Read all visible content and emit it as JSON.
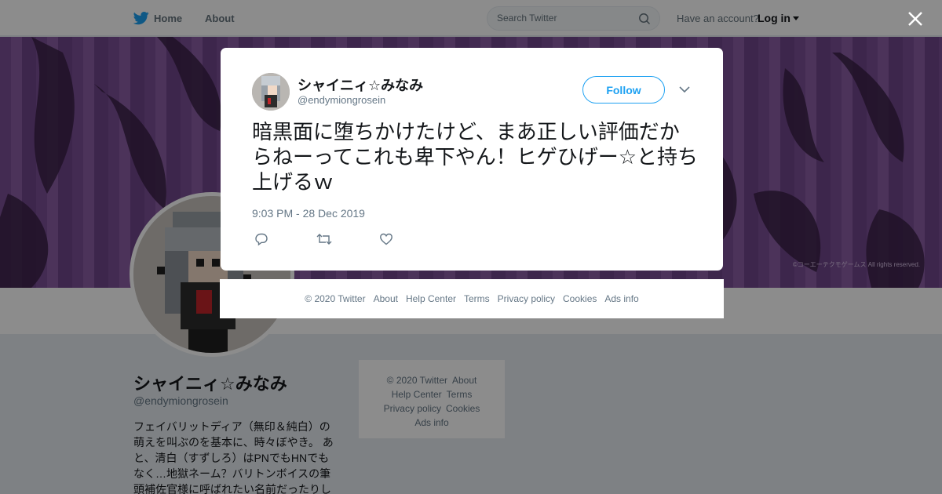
{
  "nav": {
    "home_label": "Home",
    "about_label": "About",
    "search_placeholder": "Search Twitter",
    "account_prompt": "Have an account?",
    "login_label": "Log in"
  },
  "banner": {
    "copyright": "©コーエーテクモゲームス All rights reserved."
  },
  "profile": {
    "name": "シャイニィ☆みなみ",
    "handle": "@endymiongrosein",
    "bio": "フェイバリットディア（無印＆純白）の萌えを叫ぶのを基本に、時々ぼやき。 あと、清白（すずしろ）はPNでもHNでもなく…地獄ネーム？バリトンボイスの筆頭補佐官様に呼ばれたい名前だったりし"
  },
  "side_footer": {
    "copyright": "© 2020 Twitter",
    "about": "About",
    "help": "Help Center",
    "terms": "Terms",
    "privacy": "Privacy policy",
    "cookies": "Cookies",
    "ads": "Ads info"
  },
  "tweet": {
    "name": "シャイニィ☆みなみ",
    "handle": "@endymiongrosein",
    "follow_label": "Follow",
    "text": "暗黒面に堕ちかけたけど、まあ正しい評価だからねーってこれも卑下やん！ヒゲひげー☆と持ち上げるｗ",
    "time": "9:03 PM - 28 Dec 2019"
  },
  "footer": {
    "copyright": "© 2020 Twitter",
    "about": "About",
    "help": "Help Center",
    "terms": "Terms",
    "privacy": "Privacy policy",
    "cookies": "Cookies",
    "ads": "Ads info"
  },
  "colors": {
    "accent": "#1da1f2",
    "banner": "#7a4f96",
    "text_secondary": "#657786"
  },
  "icons": {
    "logo": "twitter-bird-icon",
    "search": "search-icon",
    "close": "close-icon",
    "dropdown": "chevron-down-icon",
    "reply": "reply-icon",
    "retweet": "retweet-icon",
    "like": "heart-icon"
  }
}
